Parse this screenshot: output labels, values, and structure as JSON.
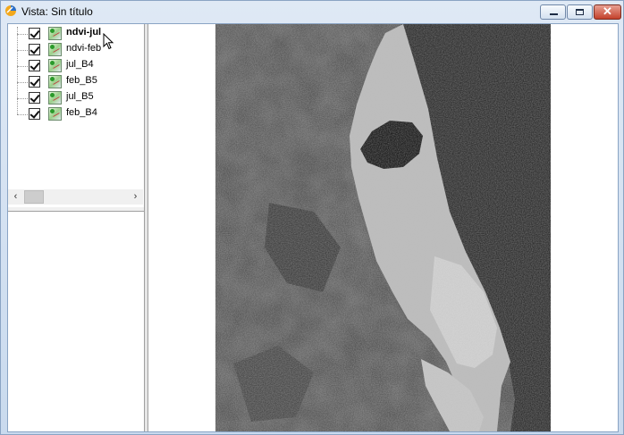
{
  "window": {
    "title": "Vista: Sin título",
    "close_glyph": "✕",
    "colors": {
      "titlebar_bg": "#dfe9f5",
      "close_red": "#c3412b"
    }
  },
  "toc": {
    "layers": [
      {
        "label": "ndvi-jul",
        "checked": true,
        "active": true,
        "icon": "raster-layer-icon"
      },
      {
        "label": "ndvi-feb",
        "checked": true,
        "active": false,
        "icon": "raster-layer-icon"
      },
      {
        "label": "jul_B4",
        "checked": true,
        "active": false,
        "icon": "raster-layer-icon"
      },
      {
        "label": "feb_B5",
        "checked": true,
        "active": false,
        "icon": "raster-layer-icon"
      },
      {
        "label": "jul_B5",
        "checked": true,
        "active": false,
        "icon": "raster-layer-icon"
      },
      {
        "label": "feb_B4",
        "checked": true,
        "active": false,
        "icon": "raster-layer-icon"
      }
    ],
    "scroll_left_glyph": "‹",
    "scroll_right_glyph": "›"
  },
  "map": {
    "content": "grayscale-satellite-raster",
    "colors": {
      "sea": "#1a1a1a",
      "land_dark": "#3c3c3c",
      "land_bright": "#cfcfcf",
      "lake": "#050505"
    }
  }
}
